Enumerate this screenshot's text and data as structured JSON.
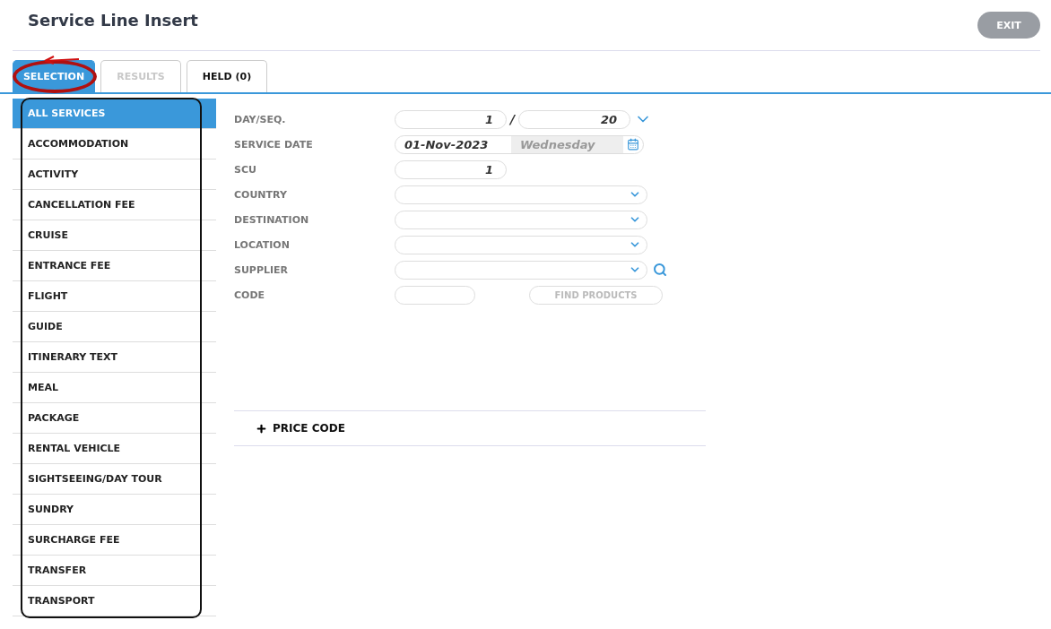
{
  "header": {
    "title": "Service Line Insert",
    "exit_button": "EXIT"
  },
  "tabs": [
    {
      "label": "SELECTION",
      "selected": true,
      "disabled": false
    },
    {
      "label": "RESULTS",
      "selected": false,
      "disabled": true
    },
    {
      "label": "HELD (0)",
      "selected": false,
      "disabled": false
    }
  ],
  "services": [
    {
      "label": "ALL SERVICES",
      "selected": true
    },
    {
      "label": "ACCOMMODATION",
      "selected": false
    },
    {
      "label": "ACTIVITY",
      "selected": false
    },
    {
      "label": "CANCELLATION FEE",
      "selected": false
    },
    {
      "label": "CRUISE",
      "selected": false
    },
    {
      "label": "ENTRANCE FEE",
      "selected": false
    },
    {
      "label": "FLIGHT",
      "selected": false
    },
    {
      "label": "GUIDE",
      "selected": false
    },
    {
      "label": "ITINERARY TEXT",
      "selected": false
    },
    {
      "label": "MEAL",
      "selected": false
    },
    {
      "label": "PACKAGE",
      "selected": false
    },
    {
      "label": "RENTAL VEHICLE",
      "selected": false
    },
    {
      "label": "SIGHTSEEING/DAY TOUR",
      "selected": false
    },
    {
      "label": "SUNDRY",
      "selected": false
    },
    {
      "label": "SURCHARGE FEE",
      "selected": false
    },
    {
      "label": "TRANSFER",
      "selected": false
    },
    {
      "label": "TRANSPORT",
      "selected": false
    }
  ],
  "form": [
    {
      "kind": "pair",
      "label": "DAY/SEQ.",
      "value": "1",
      "separator": "/",
      "value2": "20"
    },
    {
      "kind": "date",
      "label": "SERVICE DATE",
      "value": "01-Nov-2023",
      "weekday": "Wednesday"
    },
    {
      "kind": "number",
      "label": "SCU",
      "value": "1"
    },
    {
      "kind": "select",
      "label": "COUNTRY"
    },
    {
      "kind": "select",
      "label": "DESTINATION"
    },
    {
      "kind": "select",
      "label": "LOCATION"
    },
    {
      "kind": "search",
      "label": "SUPPLIER"
    },
    {
      "kind": "code",
      "label": "CODE",
      "button": "FIND PRODUCTS"
    }
  ],
  "price_code": {
    "label": "PRICE CODE",
    "expanded": false
  },
  "annotations": {
    "tab_circled": true,
    "list_framed": true
  }
}
